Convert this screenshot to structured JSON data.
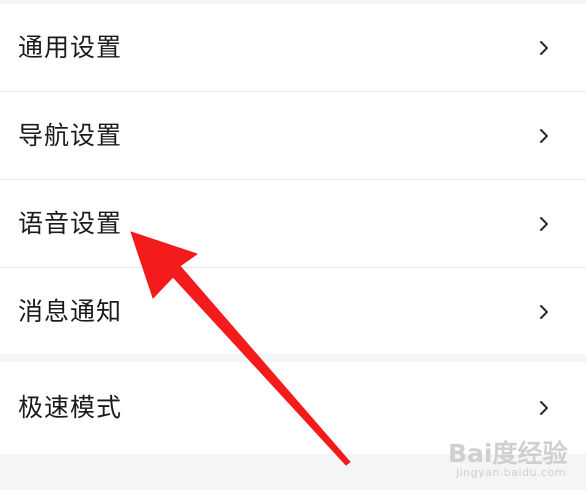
{
  "settings": {
    "items": [
      {
        "label": "通用设置"
      },
      {
        "label": "导航设置"
      },
      {
        "label": "语音设置"
      },
      {
        "label": "消息通知"
      }
    ],
    "extra_items": [
      {
        "label": "极速模式"
      }
    ]
  },
  "icons": {
    "chevron": "chevron-right-icon",
    "annotation": "red-arrow-annotation"
  },
  "colors": {
    "background": "#f4f5f7",
    "row": "#ffffff",
    "text": "#1b1b1b",
    "chevron": "#333333",
    "arrow": "#f31b1b"
  },
  "watermark": {
    "main": "Bai度经验",
    "sub": "jingyan.baidu.com"
  }
}
